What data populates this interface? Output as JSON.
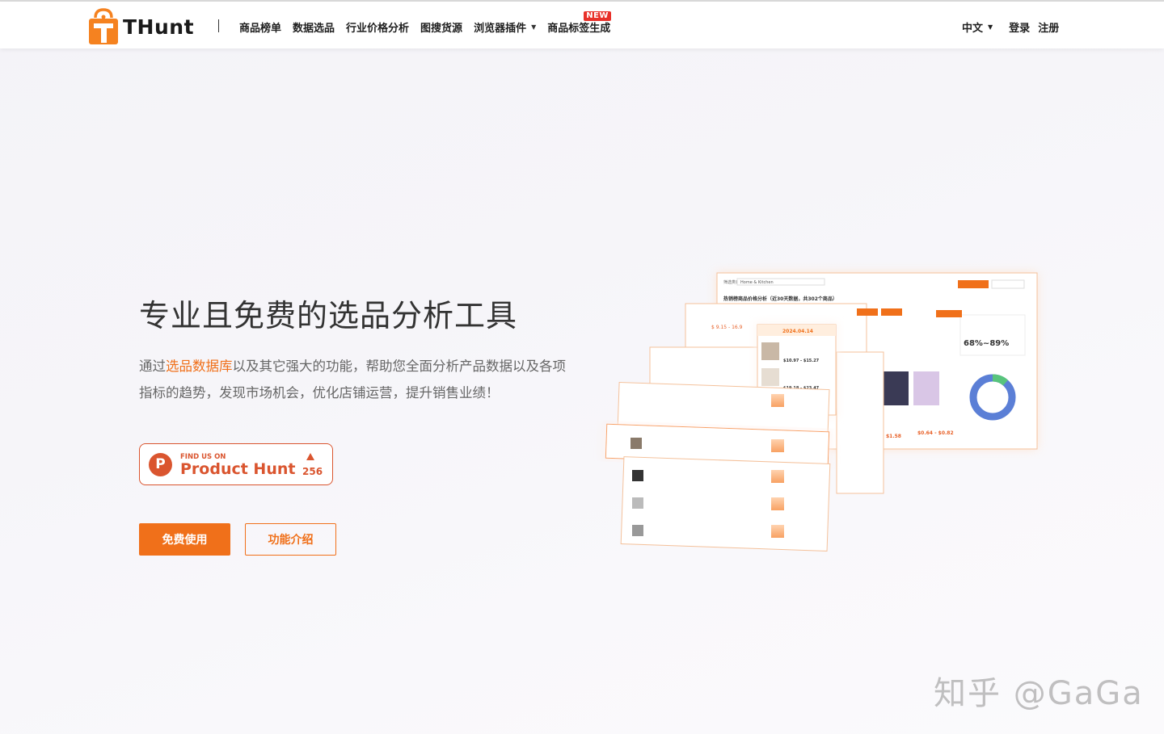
{
  "header": {
    "logo_text": "THunt",
    "nav": [
      {
        "label": "商品榜单"
      },
      {
        "label": "数据选品"
      },
      {
        "label": "行业价格分析"
      },
      {
        "label": "图搜货源"
      },
      {
        "label": "浏览器插件",
        "has_dropdown": true
      },
      {
        "label": "商品标签生成",
        "badge": "NEW"
      }
    ],
    "language": "中文",
    "login": "登录",
    "register": "注册"
  },
  "hero": {
    "title": "专业且免费的选品分析工具",
    "desc_before": "通过",
    "desc_highlight": "选品数据库",
    "desc_after": "以及其它强大的功能，帮助您全面分析产品数据以及各项指标的趋势，发现市场机会，优化店铺运营，提升销售业绩！",
    "product_hunt": {
      "small": "FIND US ON",
      "big": "Product Hunt",
      "count": "256",
      "logo_letter": "P"
    },
    "primary_button": "免费使用",
    "secondary_button": "功能介绍"
  },
  "illustration": {
    "category": "Home & Kitchen",
    "headline": "热销榜商品价格分析（近30天数据，共302个商品）",
    "price_range": "$ 9.15 - 16.9",
    "date": "2024.04.14",
    "percent": "68%~89%",
    "prices": [
      "$10.97 - $15.27",
      "$19.18 - $23.47",
      "$1.58",
      "$0.64 - $0.82"
    ]
  },
  "watermark": "知乎 @GaGa",
  "colors": {
    "accent": "#f0701a",
    "product_hunt": "#da552f",
    "badge": "#e8312a"
  }
}
